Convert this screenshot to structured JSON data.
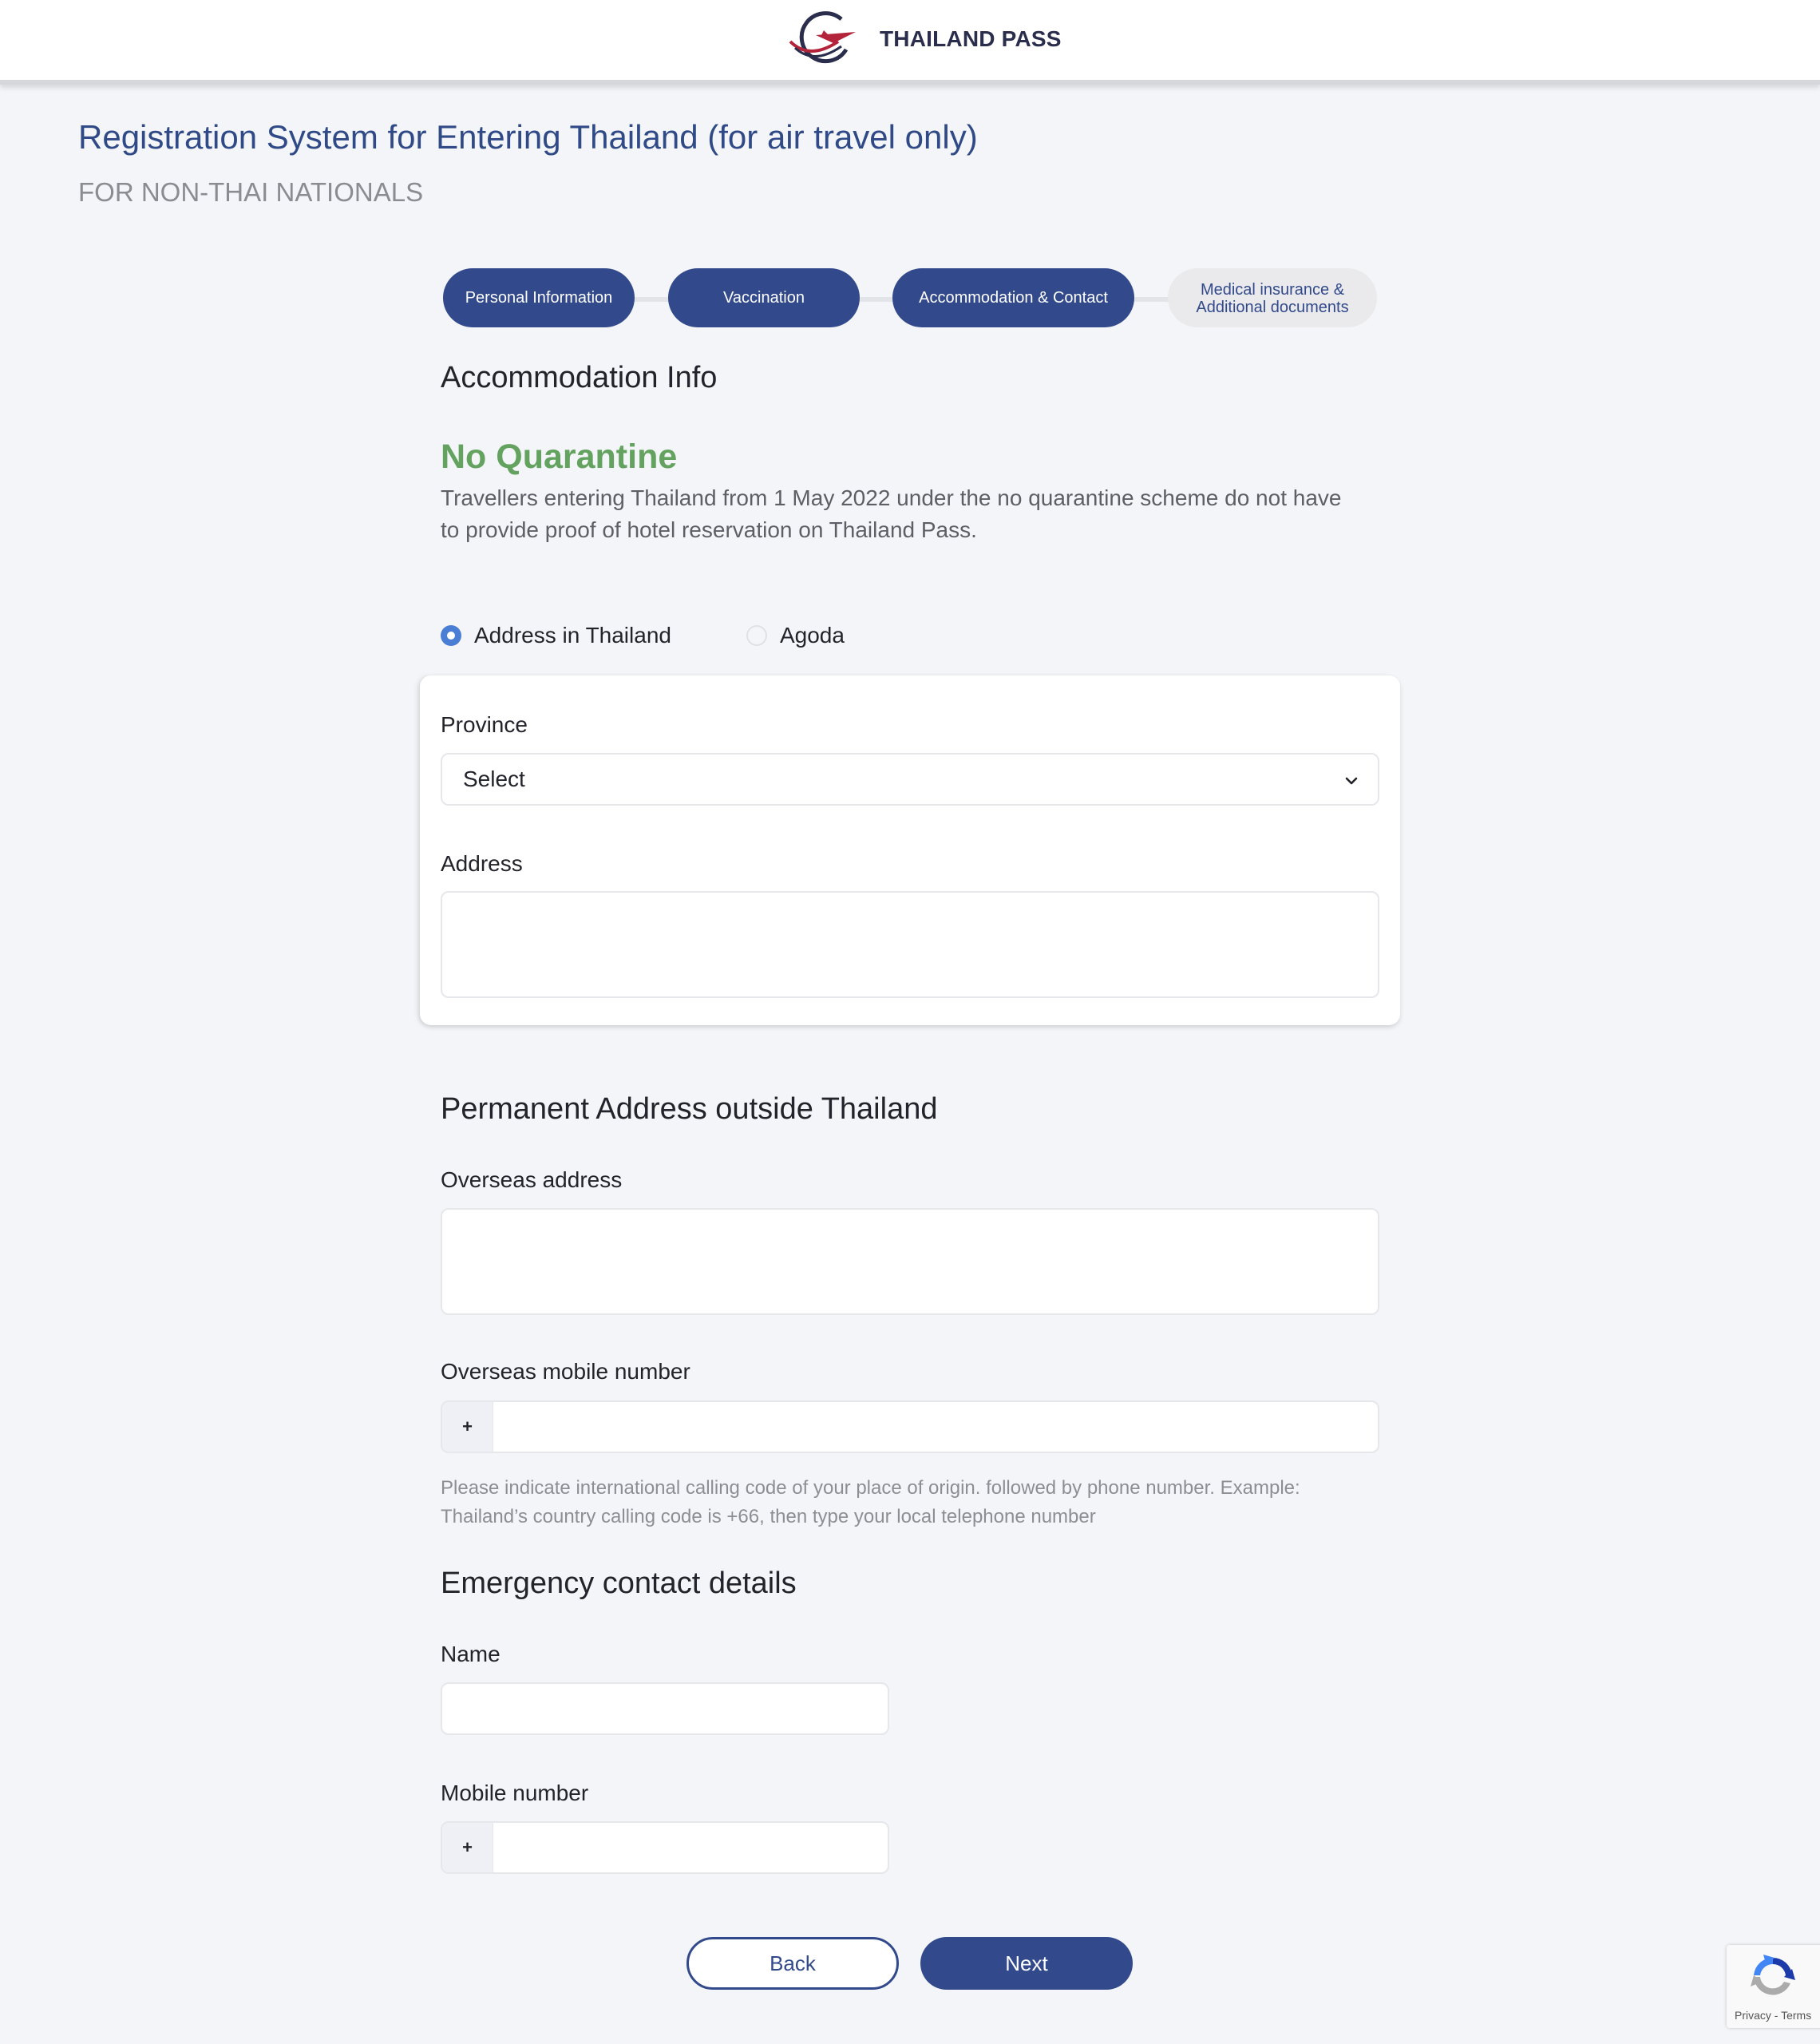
{
  "header": {
    "brand_name": "THAILAND PASS",
    "logo_icon": "plane-globe-logo"
  },
  "page": {
    "title": "Registration System for Entering Thailand (for air travel only)",
    "subtitle": "FOR NON-THAI NATIONALS"
  },
  "stepper": {
    "steps": [
      {
        "label": "Personal Information",
        "status": "completed"
      },
      {
        "label": "Vaccination",
        "status": "completed"
      },
      {
        "label": "Accommodation & Contact",
        "status": "current"
      },
      {
        "label": "Medical insurance & Additional documents",
        "status": "pending"
      }
    ]
  },
  "accommodation": {
    "heading": "Accommodation Info",
    "notice_title": "No Quarantine",
    "notice_text": "Travellers entering Thailand from 1 May 2022 under the no quarantine scheme do not have to provide proof of hotel reservation on Thailand Pass.",
    "options": [
      {
        "label": "Address in Thailand",
        "checked": true
      },
      {
        "label": "Agoda",
        "checked": false
      }
    ],
    "province_label": "Province",
    "province_value": "Select",
    "address_label": "Address",
    "address_value": ""
  },
  "permanent_address": {
    "heading": "Permanent Address outside Thailand",
    "overseas_address_label": "Overseas address",
    "overseas_address_value": "",
    "mobile_label": "Overseas mobile number",
    "mobile_prefix": "+",
    "mobile_value": "",
    "hint": "Please indicate international calling code of your place of origin. followed by phone number. Example: Thailand’s country calling code is +66, then type your local telephone number"
  },
  "emergency": {
    "heading": "Emergency contact details",
    "name_label": "Name",
    "name_value": "",
    "mobile_label": "Mobile number",
    "mobile_prefix": "+",
    "mobile_value": ""
  },
  "actions": {
    "back_label": "Back",
    "next_label": "Next"
  },
  "recaptcha": {
    "links": "Privacy - Terms"
  },
  "colors": {
    "primary": "#324a8c",
    "title": "#2f4a86",
    "success": "#63a35f",
    "radio_active": "#4a7ed4",
    "background": "#f4f5f9"
  }
}
